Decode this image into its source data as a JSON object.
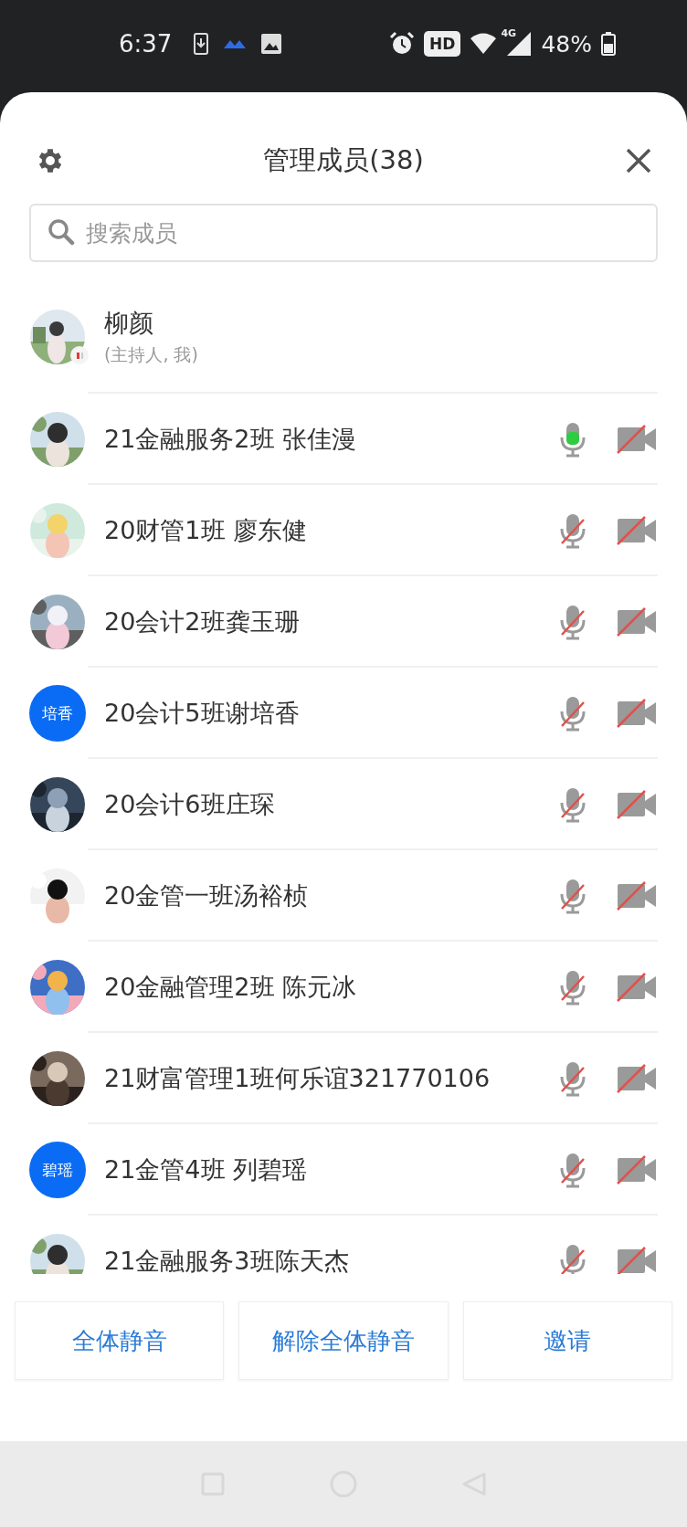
{
  "status_bar": {
    "time": "6:37",
    "hd": "HD",
    "network": "4G",
    "battery": "48%"
  },
  "sheet": {
    "title": "管理成员(38)"
  },
  "search": {
    "placeholder": "搜索成员"
  },
  "host": {
    "name": "柳颜",
    "role": "(主持人, 我)"
  },
  "members": [
    {
      "name": "21金融服务2班 张佳漫",
      "mic_on": true,
      "camera_on": false
    },
    {
      "name": "20财管1班 廖东健",
      "mic_on": false,
      "camera_on": false
    },
    {
      "name": "20会计2班龚玉珊",
      "mic_on": false,
      "camera_on": false
    },
    {
      "name": "20会计5班谢培香",
      "avatar": {
        "kind": "initials",
        "text": "培香"
      },
      "mic_on": false,
      "camera_on": false
    },
    {
      "name": "20会计6班庄琛",
      "mic_on": false,
      "camera_on": false
    },
    {
      "name": "20金管一班汤裕桢",
      "mic_on": false,
      "camera_on": false
    },
    {
      "name": "20金融管理2班 陈元冰",
      "mic_on": false,
      "camera_on": false
    },
    {
      "name": "21财富管理1班何乐谊321770106",
      "mic_on": false,
      "camera_on": false
    },
    {
      "name": "21金管4班 列碧瑶",
      "avatar": {
        "kind": "initials",
        "text": "碧瑶"
      },
      "mic_on": false,
      "camera_on": false
    },
    {
      "name": "21金融服务3班陈天杰",
      "mic_on": false,
      "camera_on": false
    }
  ],
  "buttons": [
    "全体静音",
    "解除全体静音",
    "邀请"
  ]
}
